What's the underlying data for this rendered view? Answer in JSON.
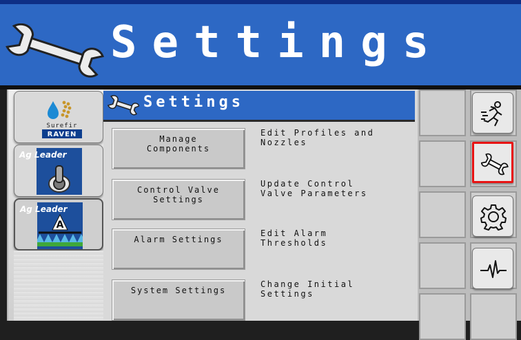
{
  "header": {
    "title": "Settings",
    "icon": "wrench-icon"
  },
  "left_panel": {
    "modules": [
      {
        "brand_top": "Surefir",
        "brand_bottom": "RAVEN",
        "icon": "raven-surefire-logo"
      },
      {
        "brand": "Ag Leader",
        "icon": "toggle-switch-icon"
      },
      {
        "brand": "Ag Leader",
        "icon": "sprayer-boom-icon",
        "letter": "A"
      }
    ]
  },
  "content": {
    "title": "Settings",
    "rows": [
      {
        "button": "Manage\nComponents",
        "description": "Edit Profiles and\nNozzles"
      },
      {
        "button": "Control Valve\nSettings",
        "description": "Update Control\nValve Parameters"
      },
      {
        "button": "Alarm Settings",
        "description": "Edit Alarm\nThresholds"
      },
      {
        "button": "System Settings",
        "description": "Change Initial\nSettings"
      }
    ]
  },
  "side_buttons": [
    {
      "icon": "running-person-icon",
      "active": false
    },
    {
      "icon": "wrench-icon",
      "active": true
    },
    {
      "icon": "gear-icon",
      "active": false
    },
    {
      "icon": "waveform-icon",
      "active": false
    }
  ],
  "colors": {
    "header_blue": "#2d68c4",
    "active_border": "#e81313",
    "panel_gray": "#d9d9d9"
  }
}
